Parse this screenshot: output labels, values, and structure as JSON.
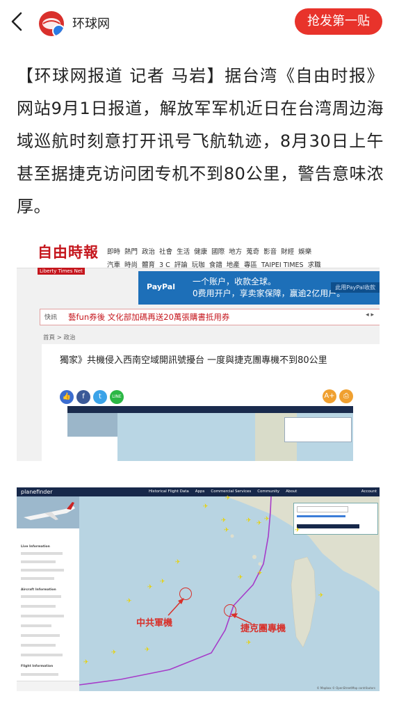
{
  "header": {
    "source_name": "环球网",
    "cta_label": "抢发第一贴"
  },
  "article": {
    "text": "【环球网报道 记者 马岩】据台湾《自由时报》网站9月1日报道，解放军军机近日在台湾周边海域巡航时刻意打开讯号飞航轨迹，8月30日上午甚至据捷克访问团专机不到80公里，警告意味浓厚。"
  },
  "screenshot1": {
    "logo_cn": "自由時報",
    "logo_en": "Liberty Times Net",
    "nav_row1": [
      "即時",
      "熱門",
      "政治",
      "社會",
      "生活",
      "健康",
      "國際",
      "地方",
      "蒐奇",
      "影音",
      "財經",
      "娛樂"
    ],
    "nav_row2": [
      "汽車",
      "時尚",
      "體育",
      "3 C",
      "評論",
      "玩咖",
      "食譜",
      "地產",
      "專區",
      "TAIPEI TIMES",
      "求職"
    ],
    "ad": {
      "brand": "PayPal",
      "line1": "一个账户，收款全球。",
      "line2": "0费用开户，享卖家保障，赢逾2亿用户。",
      "button": "此用PayPal收款"
    },
    "news_bar": {
      "tag": "快訊",
      "text": "藝fun券後 文化部加碼再送20萬張購書抵用券",
      "controls": "◂  ▸"
    },
    "breadcrumb": "首頁  >  政治",
    "headline": "獨家》共機侵入西南空域開訊號擾台 一度與捷克團專機不到80公里",
    "share_icons": [
      "like-icon",
      "facebook-icon",
      "twitter-icon",
      "line-icon"
    ],
    "share_labels": [
      "👍",
      "f",
      "t",
      "LINE"
    ],
    "tool_labels": [
      "A+",
      "⎙"
    ]
  },
  "screenshot2": {
    "app_name": "planefinder",
    "menu": [
      "Historical Flight Data",
      "Apps",
      "Commercial Services",
      "Community",
      "About"
    ],
    "account": "Account",
    "side_sections": [
      "Live Information",
      "Aircraft Information",
      "Flight Information"
    ],
    "label_pla": "中共軍機",
    "label_czech": "捷克團專機",
    "credit": "© Mapbox © OpenStreetMap contributors"
  },
  "colors": {
    "accent_red": "#e8332b",
    "liberty_red": "#c5161d",
    "paypal_blue": "#1d6fb8",
    "planefinder_navy": "#17284a",
    "flight_path": "#a63cc9",
    "map_sea": "#b8d4e2"
  }
}
